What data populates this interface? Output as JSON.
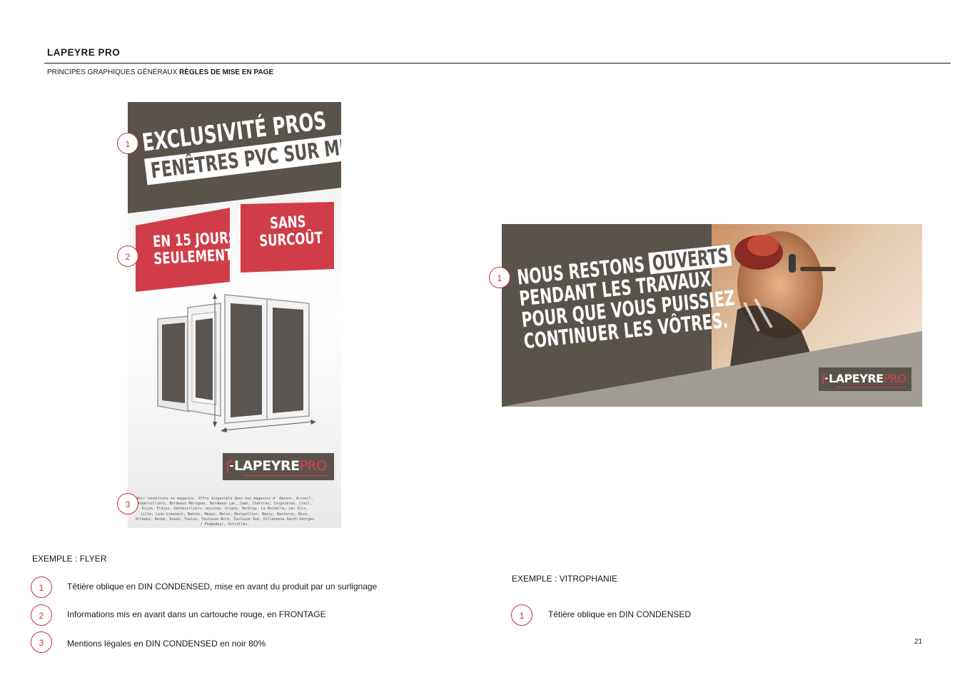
{
  "header": {
    "brand": "LAPEYRE PRO",
    "section": "PRINCIPES GRAPHIQUES GÉNÉRAUX",
    "subsection": "RÈGLES DE MISE EN PAGE"
  },
  "flyer": {
    "headline_line1": "EXCLUSIVITÉ PROS",
    "headline_line2": "FENÊTRES PVC SUR MESURE",
    "red_box_left_line1": "EN 15 JOURS",
    "red_box_left_line2": "SEULEMENT",
    "red_box_right_line1": "SANS",
    "red_box_right_line2": "SURCOÛT",
    "logo_main": "LAPEYRE",
    "logo_accent": "PRO",
    "legal": "Voir conditions en magasins. Offre disponible dans nos magasins d' Amiens, Arcueil, Aubervilliers, Bordeaux Mérignac, Bordeaux Lac, Caen, Chartres, Coignières, Creil, Dijon, Fréjus, Gennevilliers, Gournay, Grigny, Herblay, La Rochelle, Les Ulis, Lille, Lyon Limonest, Mantes, Meaux, Melun, Montpellier, Nancy, Nanterre, Nice, Orléans, Reims, Rouen, Toulon, Toulouse Nord, Toulouse Sud, Villeneuve Saint-Georges / Pompadour, Vitrolles.",
    "caption": "EXEMPLE : FLYER"
  },
  "vitrophanie": {
    "line1_prefix": "NOUS RESTONS",
    "line1_highlight": "OUVERTS",
    "line2": "PENDANT LES TRAVAUX",
    "line3": "POUR QUE VOUS PUISSIEZ",
    "line4": "CONTINUER LES VÔTRES.",
    "logo_main": "LAPEYRE",
    "logo_accent": "PRO",
    "caption": "EXEMPLE : VITROPHANIE"
  },
  "markers": {
    "one": "1",
    "two": "2",
    "three": "3"
  },
  "legend_flyer": [
    {
      "num": "1",
      "text": "Têtière oblique en DIN CONDENSED, mise en avant du produit par un surlignage"
    },
    {
      "num": "2",
      "text": "Informations mis en avant dans un cartouche rouge, en FRONTAGE"
    },
    {
      "num": "3",
      "text": "Mentions légales en DIN CONDENSED en noir 80%"
    }
  ],
  "legend_vitro": [
    {
      "num": "1",
      "text": "Têtière oblique en DIN CONDENSED"
    }
  ],
  "page_number": "21",
  "colors": {
    "brand_grey": "#59534c",
    "brand_red": "#d03d48",
    "marker_red": "#c9313d"
  }
}
